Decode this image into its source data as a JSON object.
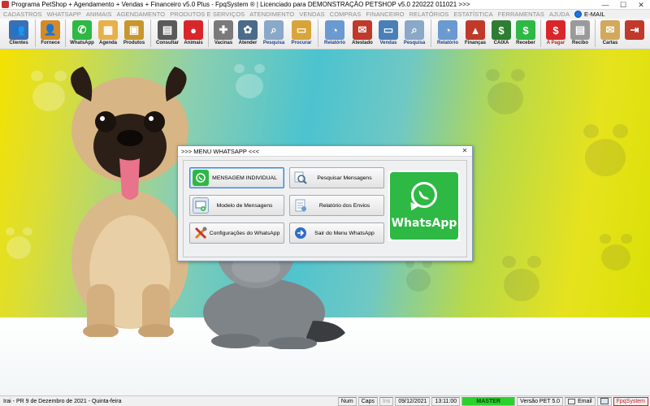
{
  "window": {
    "title": "Programa PetShop + Agendamento + Vendas + Financeiro v5.0 Plus - FpqSystem ® | Licenciado para  DEMONSTRAÇÃO PETSHOP v5.0 220222 011021 >>>",
    "minimize": "—",
    "maximize": "☐",
    "close": "✕"
  },
  "menubar": {
    "items": [
      "CADASTROS",
      "WHATSAPP",
      "ANIMAIS",
      "AGENDAMENTO",
      "PRODUTOS E SERVIÇOS",
      "ATENDIMENTO",
      "VENDAS",
      "COMPRAS",
      "FINANCEIRO",
      "RELATÓRIOS",
      "ESTATÍSTICA",
      "FERRAMENTAS",
      "AJUDA"
    ],
    "email": "E-MAIL"
  },
  "toolbar": {
    "buttons": [
      {
        "label": "Clientes",
        "icon": "clients-icon",
        "color": "#3b6fb5"
      },
      {
        "label": "Fornece",
        "icon": "suppliers-icon",
        "color": "#d48a2a"
      },
      {
        "label": "WhatsApp",
        "icon": "whatsapp-icon",
        "color": "#2eb844"
      },
      {
        "label": "Agenda",
        "icon": "calendar-icon",
        "color": "#e8b04a"
      },
      {
        "label": "Produtos",
        "icon": "boxes-icon",
        "color": "#c8962e"
      },
      {
        "label": "Consultar",
        "icon": "register-icon",
        "color": "#5a5a5a"
      },
      {
        "label": "Animais",
        "icon": "paw-icon",
        "color": "#d9262b"
      },
      {
        "label": "Vacinas",
        "icon": "vaccine-icon",
        "color": "#7a7a7a"
      },
      {
        "label": "Atender",
        "icon": "pet-care-icon",
        "color": "#4a6b8a"
      },
      {
        "label": "Pesquisa",
        "icon": "magnifier-icon",
        "color": "#8aa8c8"
      },
      {
        "label": "Procurar",
        "icon": "folder-icon",
        "color": "#d9a53a"
      },
      {
        "label": "Relatório",
        "icon": "report-icon",
        "color": "#6a9ad0"
      },
      {
        "label": "Atestado",
        "icon": "certificate-icon",
        "color": "#c0392b"
      },
      {
        "label": "Vendas",
        "icon": "laptop-icon",
        "color": "#4a7fb8"
      },
      {
        "label": "Pesquisa",
        "icon": "magnifier-doc-icon",
        "color": "#8aa8c8"
      },
      {
        "label": "Relatório",
        "icon": "report-chart-icon",
        "color": "#6a9ad0"
      },
      {
        "label": "Finanças",
        "icon": "finance-chart-icon",
        "color": "#c0392b"
      },
      {
        "label": "CAIXA",
        "icon": "cash-icon",
        "color": "#2e7d32"
      },
      {
        "label": "Receber",
        "icon": "dollar-green-icon",
        "color": "#2eb844"
      },
      {
        "label": "A Pagar",
        "icon": "dollar-red-icon",
        "color": "#d9262b"
      },
      {
        "label": "Recibo",
        "icon": "receipt-icon",
        "color": "#9a9a9a"
      },
      {
        "label": "Cartas",
        "icon": "letter-icon",
        "color": "#d2a95a"
      },
      {
        "label": "",
        "icon": "exit-icon",
        "color": "#c0392b"
      }
    ]
  },
  "dialog": {
    "title": ">>> MENU WHATSAPP <<<",
    "close": "✕",
    "buttons": {
      "individual": "MENSAGEM INDIVIDUAL",
      "templates": "Modelo de Mensagens",
      "settings": "Configurações do WhatsApp",
      "search": "Pesquisar Mensagens",
      "report": "Relatório dos Envios",
      "exit": "Sair do Menu WhatsApp"
    },
    "logo_text": "WhatsApp"
  },
  "statusbar": {
    "location": "Irai - PR  9 de Dezembro de 2021 - Quinta-feira",
    "num": "Num",
    "caps": "Caps",
    "ins": "Ins",
    "date": "09/12/2021",
    "time": "13:11:00",
    "user": "MASTER",
    "version": "Versão PET 5.0",
    "email": "Email",
    "brand": "FpqSystem"
  },
  "colors": {
    "whatsapp_green": "#2eb844",
    "master_green": "#2bd12b",
    "focus_blue": "#3c7fd0",
    "brand_red": "#c0272d"
  }
}
